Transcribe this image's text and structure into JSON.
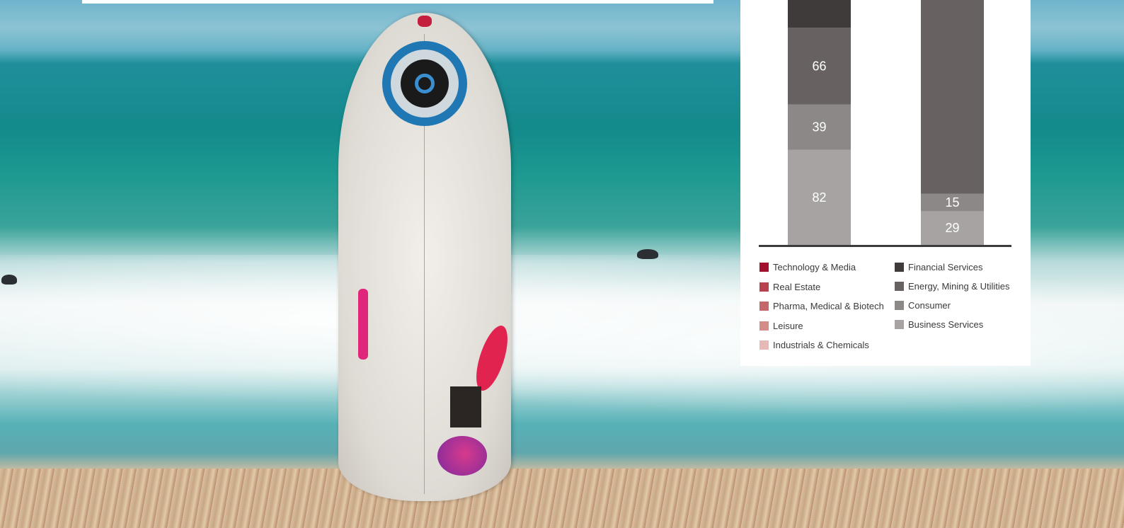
{
  "chart_data": {
    "type": "bar",
    "stacked": true,
    "categories": [
      "",
      ""
    ],
    "series": [
      {
        "name": "Business Services",
        "color": "#a7a3a2",
        "values": [
          82,
          29
        ]
      },
      {
        "name": "Consumer",
        "color": "#8c8887",
        "values": [
          39,
          15
        ]
      },
      {
        "name": "Energy, Mining & Utilities",
        "color": "#676261",
        "values": [
          66,
          null
        ]
      },
      {
        "name": "Financial Services",
        "color": "#3e3b3a",
        "values": [
          null,
          null
        ]
      }
    ],
    "data_labels": [
      {
        "series": "Business Services",
        "category_index": 0,
        "text": "82"
      },
      {
        "series": "Consumer",
        "category_index": 0,
        "text": "39"
      },
      {
        "series": "Energy, Mining & Utilities",
        "category_index": 0,
        "text": "66"
      },
      {
        "series": "Business Services",
        "category_index": 1,
        "text": "29"
      },
      {
        "series": "Consumer",
        "category_index": 1,
        "text": "15"
      }
    ],
    "legend": {
      "placement": "bottom",
      "columns": [
        [
          {
            "label": "Technology & Media",
            "color": "#a3102f"
          },
          {
            "label": "Real Estate",
            "color": "#b8404f"
          },
          {
            "label": "Pharma, Medical & Biotech",
            "color": "#c4676a"
          },
          {
            "label": "Leisure",
            "color": "#d38c8a"
          },
          {
            "label": "Industrials & Chemicals",
            "color": "#e6b8b6"
          }
        ],
        [
          {
            "label": "Financial Services",
            "color": "#3e3b3a"
          },
          {
            "label": "Energy, Mining & Utilities",
            "color": "#676261"
          },
          {
            "label": "Consumer",
            "color": "#8c8887"
          },
          {
            "label": "Business Services",
            "color": "#a7a3a2"
          }
        ]
      ]
    },
    "note": "Chart is cropped at the top of the image; upper segments are cut off."
  }
}
